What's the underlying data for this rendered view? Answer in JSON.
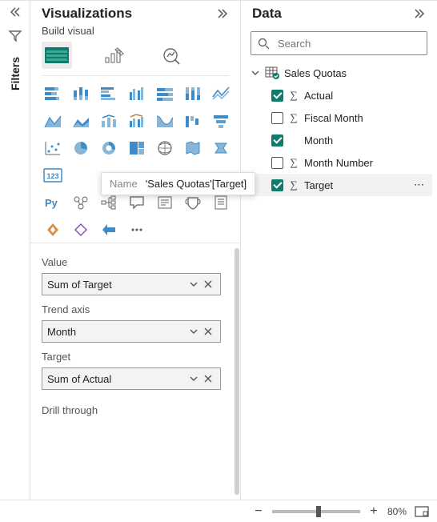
{
  "filtersPanel": {
    "title": "Filters"
  },
  "vizPanel": {
    "title": "Visualizations",
    "subtitle": "Build visual",
    "tooltip": {
      "label": "Name",
      "value": "'Sales Quotas'[Target]"
    },
    "wells": {
      "valueLabel": "Value",
      "valueField": "Sum of Target",
      "trendLabel": "Trend axis",
      "trendField": "Month",
      "targetLabel": "Target",
      "targetField": "Sum of Actual",
      "drillLabel": "Drill through"
    }
  },
  "dataPanel": {
    "title": "Data",
    "searchPlaceholder": "Search",
    "tableName": "Sales Quotas",
    "fields": [
      {
        "name": "Actual",
        "checked": true,
        "sigma": true
      },
      {
        "name": "Fiscal Month",
        "checked": false,
        "sigma": true
      },
      {
        "name": "Month",
        "checked": true,
        "sigma": false
      },
      {
        "name": "Month Number",
        "checked": false,
        "sigma": true
      },
      {
        "name": "Target",
        "checked": true,
        "sigma": true
      }
    ]
  },
  "status": {
    "zoom": "80%"
  }
}
